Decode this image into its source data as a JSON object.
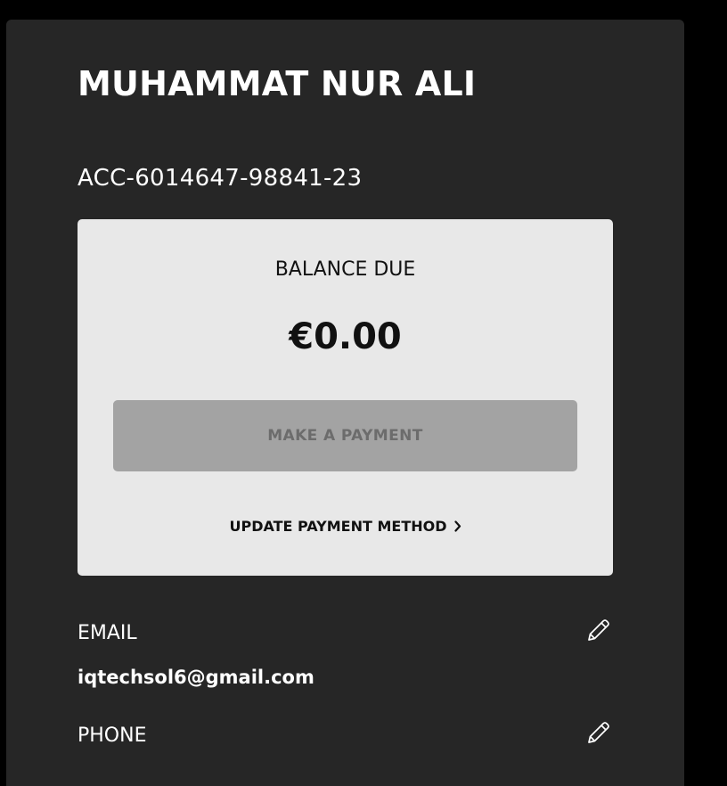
{
  "profile": {
    "name": "MUHAMMAT NUR ALI",
    "account_number": "ACC-6014647-98841-23"
  },
  "balance": {
    "label": "BALANCE DUE",
    "amount": "€0.00",
    "pay_button_label": "MAKE A PAYMENT",
    "update_link_label": "UPDATE PAYMENT METHOD"
  },
  "fields": {
    "email": {
      "label": "EMAIL",
      "value": "iqtechsol6@gmail.com",
      "icon": "pencil-icon"
    },
    "phone": {
      "label": "PHONE",
      "icon": "pencil-icon"
    }
  },
  "colors": {
    "page_background": "#000000",
    "panel_background": "#262626",
    "card_background": "#e8e8e8",
    "button_disabled": "#a3a3a3",
    "button_text_disabled": "#6c6c6c"
  }
}
